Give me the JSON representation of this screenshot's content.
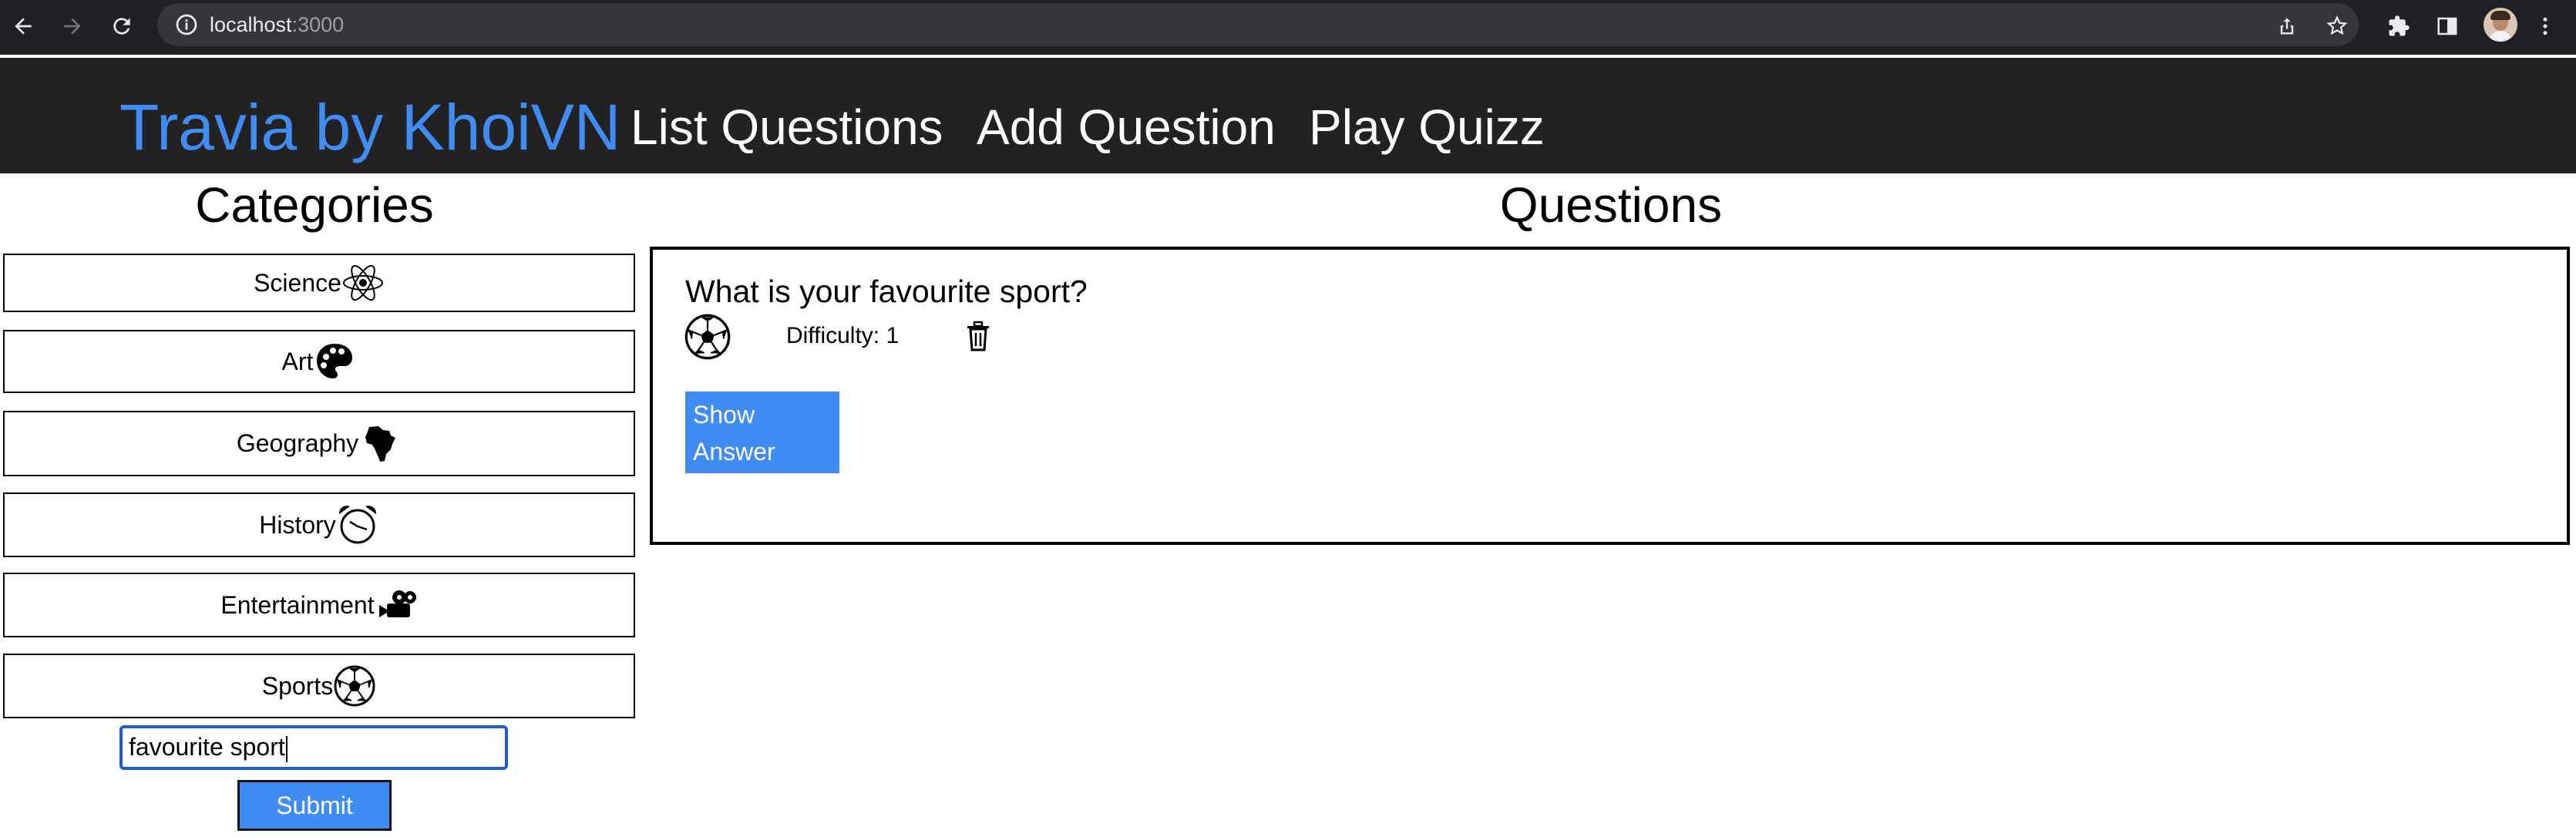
{
  "browser": {
    "url_host": "localhost",
    "url_port": ":3000"
  },
  "header": {
    "brand": "Travia by KhoiVN",
    "nav": [
      "List Questions",
      "Add Question",
      "Play Quizz"
    ]
  },
  "categories": {
    "title": "Categories",
    "items": [
      {
        "label": "Science",
        "icon": "atom-icon"
      },
      {
        "label": "Art",
        "icon": "palette-icon"
      },
      {
        "label": "Geography",
        "icon": "africa-icon"
      },
      {
        "label": "History",
        "icon": "alarm-clock-icon"
      },
      {
        "label": "Entertainment",
        "icon": "film-camera-icon"
      },
      {
        "label": "Sports",
        "icon": "soccer-ball-icon"
      }
    ]
  },
  "search": {
    "value": "favourite sport",
    "submit_label": "Submit"
  },
  "questions": {
    "title": "Questions",
    "items": [
      {
        "question": "What is your favourite sport?",
        "category_icon": "soccer-ball-icon",
        "difficulty": "Difficulty: 1",
        "show_answer_label": "Show Answer"
      }
    ]
  },
  "colors": {
    "brand": "#3f8cf4",
    "header_bg": "#222222",
    "button_bg": "#3f8cf4"
  }
}
